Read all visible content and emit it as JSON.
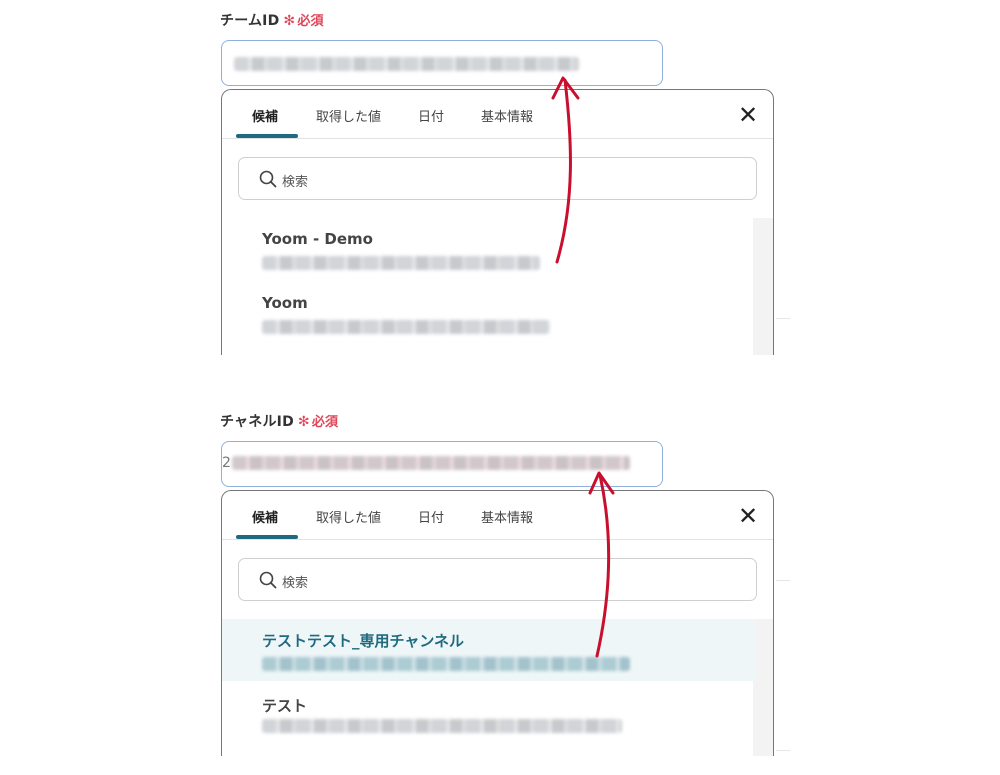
{
  "sections": [
    {
      "field_label": "チームID",
      "required_star": "✻",
      "required_text": "必須",
      "tabs": [
        "候補",
        "取得した値",
        "日付",
        "基本情報"
      ],
      "search_placeholder": "検索",
      "items": [
        "Yoom - Demo",
        "Yoom"
      ]
    },
    {
      "field_label": "チャネルID",
      "required_star": "✻",
      "required_text": "必須",
      "input_prefix": "2",
      "tabs": [
        "候補",
        "取得した値",
        "日付",
        "基本情報"
      ],
      "search_placeholder": "検索",
      "items": [
        "テストテスト_専用チャンネル",
        "テスト"
      ]
    }
  ],
  "close_icon": "close-icon",
  "search_icon": "search-icon",
  "colors": {
    "accent": "#1f6a80",
    "required": "#e0465a",
    "arrow": "#c8102e",
    "input_border": "#8fb0dc"
  }
}
